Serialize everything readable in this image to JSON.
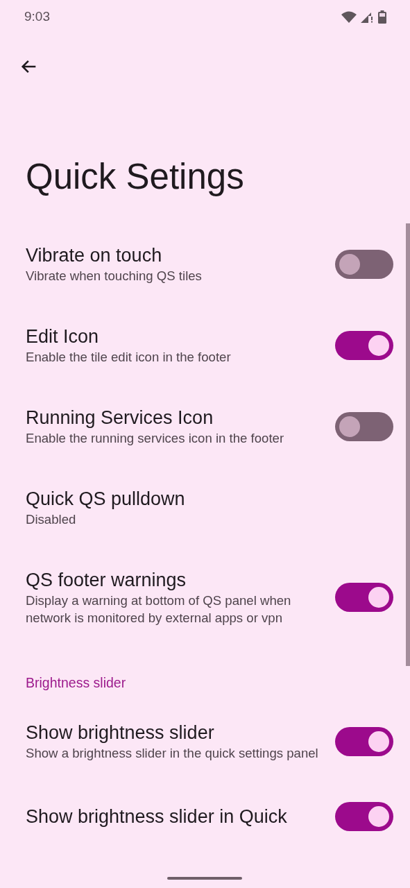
{
  "status_bar": {
    "time": "9:03"
  },
  "title": "Quick Setings",
  "items": [
    {
      "kind": "toggle",
      "title": "Vibrate on touch",
      "summary": "Vibrate when touching QS tiles",
      "on": false
    },
    {
      "kind": "toggle",
      "title": "Edit Icon",
      "summary": "Enable the tile edit icon in the footer",
      "on": true
    },
    {
      "kind": "toggle",
      "title": "Running Services Icon",
      "summary": "Enable the running services icon in the footer",
      "on": false
    },
    {
      "kind": "plain",
      "title": "Quick QS pulldown",
      "summary": "Disabled"
    },
    {
      "kind": "toggle",
      "title": "QS footer warnings",
      "summary": "Display a warning at bottom of QS panel when network is monitored by external apps or vpn",
      "on": true
    },
    {
      "kind": "header",
      "title": "Brightness slider"
    },
    {
      "kind": "toggle",
      "title": "Show brightness slider",
      "summary": "Show a brightness slider in the quick settings panel",
      "on": true
    },
    {
      "kind": "toggle",
      "title": "Show brightness slider in Quick",
      "on": true
    }
  ]
}
